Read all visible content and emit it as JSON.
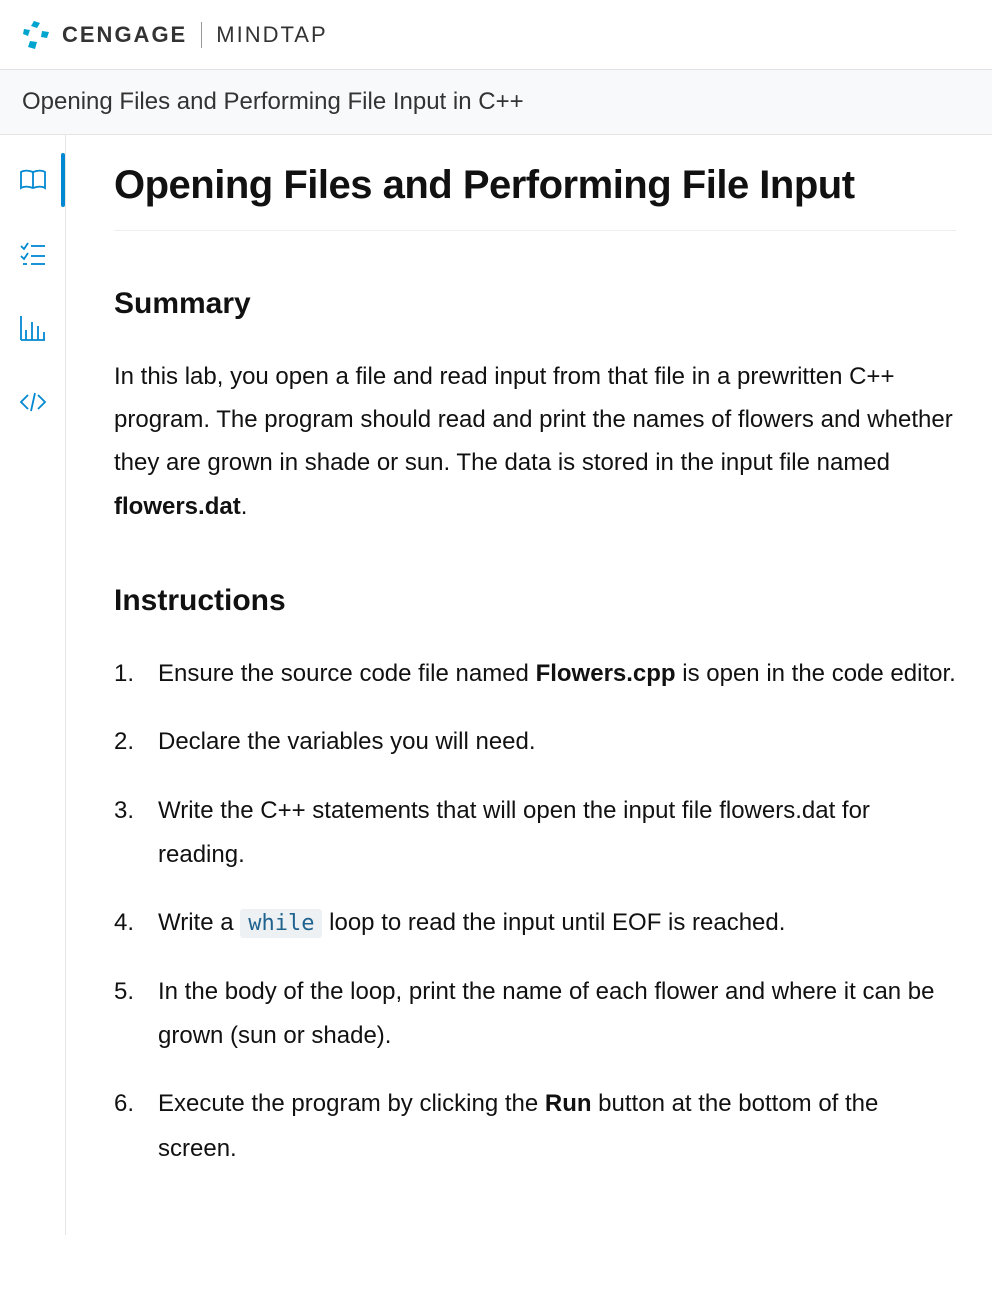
{
  "header": {
    "brand": "CENGAGE",
    "product": "MINDTAP"
  },
  "breadcrumb": "Opening Files and Performing File Input in C++",
  "sidebar": {
    "items": [
      {
        "name": "book"
      },
      {
        "name": "tasks"
      },
      {
        "name": "chart"
      },
      {
        "name": "code"
      }
    ]
  },
  "main": {
    "title": "Opening Files and Performing File Input",
    "summary_heading": "Summary",
    "summary_pre": "In this lab, you open a file and read input from that file in a prewritten C++ program. The program should read and print the names of flowers and whether they are grown in shade or sun. The data is stored in the input file named ",
    "summary_bold": "flowers.dat",
    "summary_post": ".",
    "instructions_heading": "Instructions",
    "steps": {
      "s1_pre": "Ensure the source code file named ",
      "s1_bold": "Flowers.cpp",
      "s1_post": " is open in the code editor.",
      "s2": "Declare the variables you will need.",
      "s3": "Write the C++ statements that will open the input file flowers.dat for reading.",
      "s4_pre": "Write a ",
      "s4_code": "while",
      "s4_post": " loop to read the input until EOF is reached.",
      "s5": "In the body of the loop, print the name of each flower and where it can be grown (sun or shade).",
      "s6_pre": "Execute the program by clicking the ",
      "s6_bold": "Run",
      "s6_post": " button at the bottom of the screen."
    }
  }
}
